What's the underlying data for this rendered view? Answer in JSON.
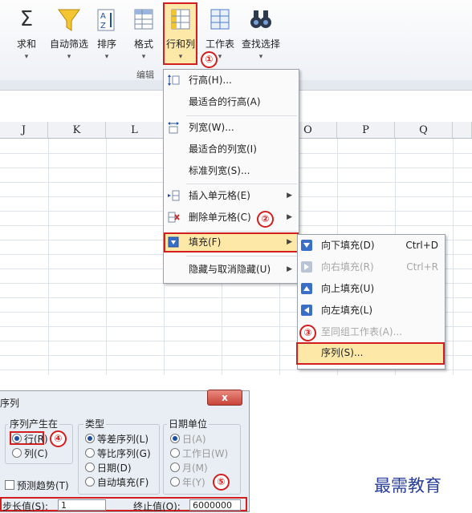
{
  "ribbon": {
    "buttons": [
      {
        "label": "求和"
      },
      {
        "label": "自动筛选"
      },
      {
        "label": "排序"
      },
      {
        "label": "格式"
      },
      {
        "label": "行和列"
      },
      {
        "label": "工作表"
      },
      {
        "label": "查找选择"
      }
    ],
    "group_label": "编辑"
  },
  "columns": [
    "J",
    "K",
    "L",
    "O",
    "P",
    "Q"
  ],
  "menu1": {
    "items": [
      "行高(H)...",
      "最适合的行高(A)",
      "列宽(W)...",
      "最适合的列宽(I)",
      "标准列宽(S)...",
      "插入单元格(E)",
      "删除单元格(C)",
      "填充(F)",
      "隐藏与取消隐藏(U)"
    ]
  },
  "menu2": {
    "items": [
      {
        "label": "向下填充(D)",
        "key": "Ctrl+D"
      },
      {
        "label": "向右填充(R)",
        "key": "Ctrl+R"
      },
      {
        "label": "向上填充(U)",
        "key": ""
      },
      {
        "label": "向左填充(L)",
        "key": ""
      },
      {
        "label": "至同组工作表(A)...",
        "key": ""
      },
      {
        "label": "序列(S)...",
        "key": ""
      }
    ]
  },
  "markers": [
    "①",
    "②",
    "③",
    "④",
    "⑤"
  ],
  "dialog": {
    "title": "序列",
    "close_label": "x",
    "series_in": {
      "legend": "序列产生在",
      "options": [
        "行(R)",
        "列(C)"
      ]
    },
    "type": {
      "legend": "类型",
      "options": [
        "等差序列(L)",
        "等比序列(G)",
        "日期(D)",
        "自动填充(F)"
      ]
    },
    "date_unit": {
      "legend": "日期单位",
      "options": [
        "日(A)",
        "工作日(W)",
        "月(M)",
        "年(Y)"
      ]
    },
    "trend_label": "预测趋势(T)",
    "step_label": "步长值(S):",
    "step_value": "1",
    "stop_label": "终止值(O):",
    "stop_value": "6000000"
  },
  "watermark": "最需教育"
}
